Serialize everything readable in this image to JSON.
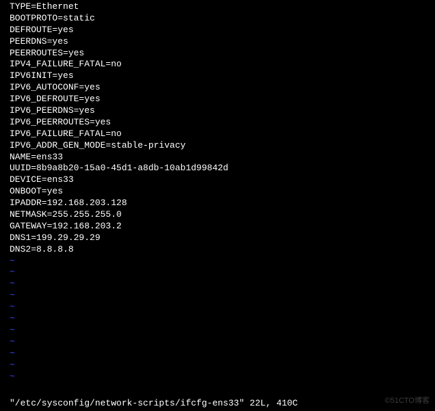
{
  "config_lines": [
    "TYPE=Ethernet",
    "BOOTPROTO=static",
    "DEFROUTE=yes",
    "PEERDNS=yes",
    "PEERROUTES=yes",
    "IPV4_FAILURE_FATAL=no",
    "IPV6INIT=yes",
    "IPV6_AUTOCONF=yes",
    "IPV6_DEFROUTE=yes",
    "IPV6_PEERDNS=yes",
    "IPV6_PEERROUTES=yes",
    "IPV6_FAILURE_FATAL=no",
    "IPV6_ADDR_GEN_MODE=stable-privacy",
    "NAME=ens33",
    "UUID=8b9a8b20-15a0-45d1-a8db-10ab1d99842d",
    "DEVICE=ens33",
    "ONBOOT=yes",
    "IPADDR=192.168.203.128",
    "NETMASK=255.255.255.0",
    "GATEWAY=192.168.203.2",
    "DNS1=199.29.29.29",
    "DNS2=8.8.8.8"
  ],
  "tilde": "~",
  "tilde_count": 11,
  "status_line": "\"/etc/sysconfig/network-scripts/ifcfg-ens33\" 22L, 410C",
  "watermark": "©51CTO博客"
}
